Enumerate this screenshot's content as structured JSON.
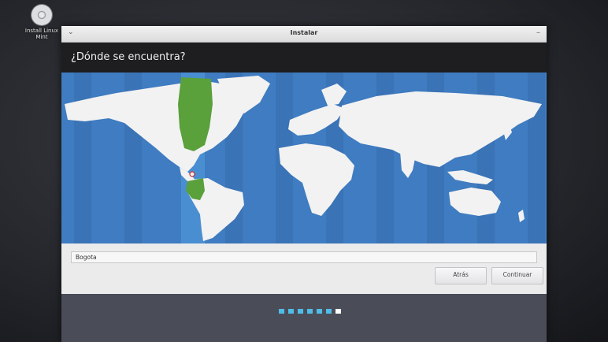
{
  "desktop": {
    "icon_label": "Install Linux Mint"
  },
  "window": {
    "title": "Instalar",
    "heading": "¿Dónde se encuentra?"
  },
  "timezone": {
    "value": "Bogota"
  },
  "buttons": {
    "back": "Atrás",
    "continue": "Continuar"
  },
  "progress": {
    "total_steps": 7,
    "current_step": 7
  },
  "colors": {
    "ocean": "#3f7cc1",
    "land": "#f2f2f2",
    "selected_zone": "#5aa03b",
    "progress_dot": "#4fbde6"
  }
}
